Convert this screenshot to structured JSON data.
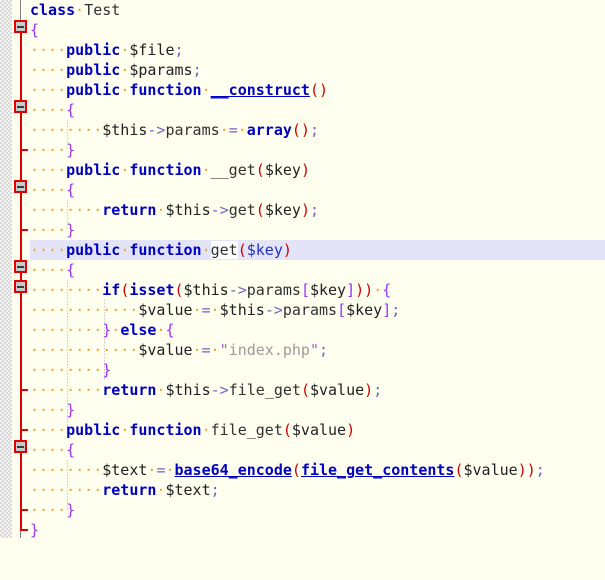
{
  "editor": {
    "language": "PHP",
    "font_size_px": 15,
    "line_height_px": 20,
    "colors": {
      "background": "#fffff0",
      "current_line": "#e4e4f8",
      "gutter_hatch": "#d8d8d8",
      "scope_line": "#e00000",
      "scope_line_outer": "#808080",
      "keyword": "#0000c0",
      "function": "#0000c0",
      "variable": "#202020",
      "operator": "#7a5fbd",
      "bracket": "#9b30ff",
      "paren": "#d00000",
      "string": "#9a9a9a",
      "quote": "#b060d0",
      "indent_dot": "#e8a33d",
      "match_highlight": "#ffffff"
    },
    "current_line_number": 13,
    "match_highlight_word": "get"
  },
  "code": {
    "lines": [
      {
        "n": 1,
        "indent": 0,
        "text": "class·Test"
      },
      {
        "n": 2,
        "indent": 0,
        "text": "{"
      },
      {
        "n": 3,
        "indent": 1,
        "text": "····public·$file;"
      },
      {
        "n": 4,
        "indent": 1,
        "text": "····public·$params;"
      },
      {
        "n": 5,
        "indent": 1,
        "text": "····public·function·__construct()"
      },
      {
        "n": 6,
        "indent": 1,
        "text": "····{"
      },
      {
        "n": 7,
        "indent": 2,
        "text": "········$this->params·=·array();"
      },
      {
        "n": 8,
        "indent": 1,
        "text": "····}"
      },
      {
        "n": 9,
        "indent": 1,
        "text": "····public·function·__get($key)"
      },
      {
        "n": 10,
        "indent": 1,
        "text": "····{"
      },
      {
        "n": 11,
        "indent": 2,
        "text": "········return·$this->get($key);"
      },
      {
        "n": 12,
        "indent": 1,
        "text": "····}"
      },
      {
        "n": 13,
        "indent": 1,
        "text": "····public·function·get($key)"
      },
      {
        "n": 14,
        "indent": 1,
        "text": "····{"
      },
      {
        "n": 15,
        "indent": 2,
        "text": "········if(isset($this->params[$key]))·{"
      },
      {
        "n": 16,
        "indent": 3,
        "text": "············$value·=·$this->params[$key];"
      },
      {
        "n": 17,
        "indent": 2,
        "text": "········}·else·{"
      },
      {
        "n": 18,
        "indent": 3,
        "text": "············$value·=·\"index.php\";"
      },
      {
        "n": 19,
        "indent": 2,
        "text": "········}"
      },
      {
        "n": 20,
        "indent": 2,
        "text": "········return·$this->file_get($value);"
      },
      {
        "n": 21,
        "indent": 1,
        "text": "····}"
      },
      {
        "n": 22,
        "indent": 1,
        "text": "····public·function·file_get($value)"
      },
      {
        "n": 23,
        "indent": 1,
        "text": "····{"
      },
      {
        "n": 24,
        "indent": 2,
        "text": "········$text·=·base64_encode(file_get_contents($value));"
      },
      {
        "n": 25,
        "indent": 2,
        "text": "········return·$text;"
      },
      {
        "n": 26,
        "indent": 1,
        "text": "····}"
      },
      {
        "n": 27,
        "indent": 0,
        "text": "}"
      }
    ]
  },
  "fold_markers": [
    {
      "line": 2,
      "state": "expanded",
      "color": "#e00000"
    },
    {
      "line": 6,
      "state": "expanded",
      "color": "#e00000"
    },
    {
      "line": 10,
      "state": "expanded",
      "color": "#e00000"
    },
    {
      "line": 14,
      "state": "expanded",
      "color": "#e00000"
    },
    {
      "line": 15,
      "state": "expanded",
      "color": "#e00000"
    },
    {
      "line": 23,
      "state": "expanded",
      "color": "#e00000"
    }
  ]
}
